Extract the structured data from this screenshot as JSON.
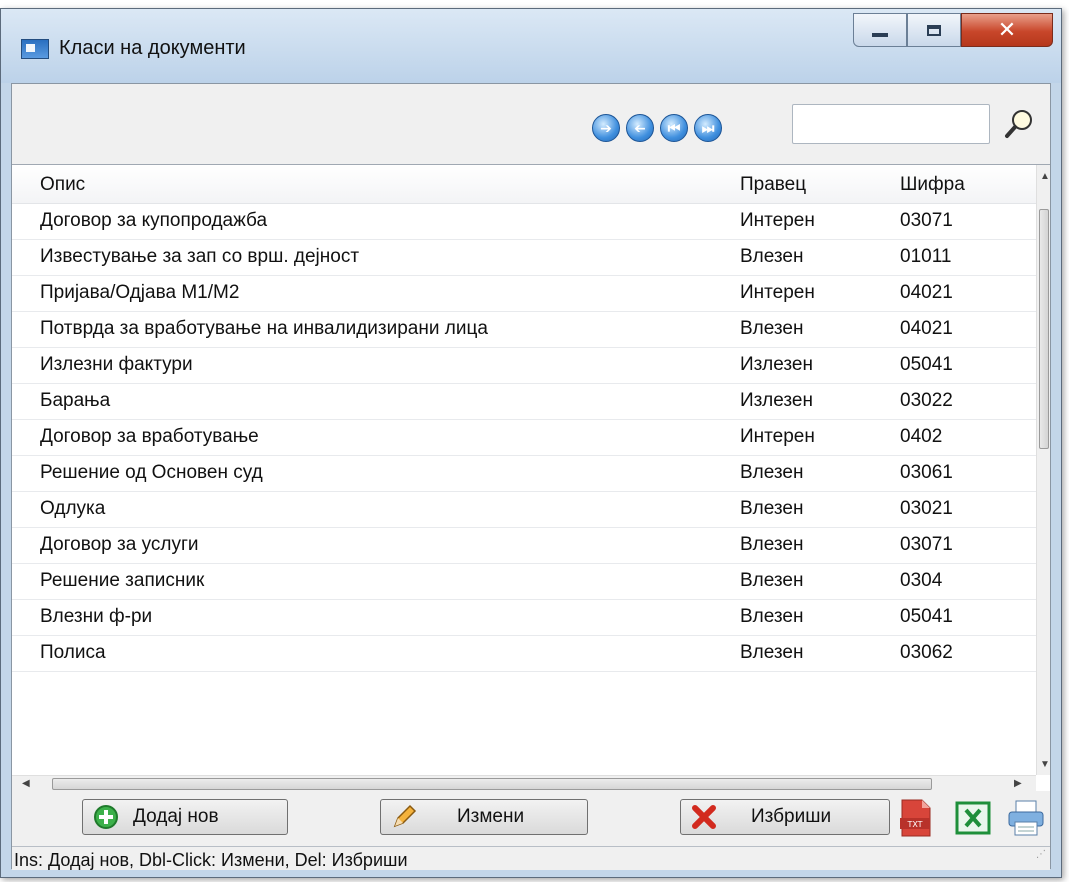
{
  "window": {
    "title": "Класи на документи"
  },
  "toolbar": {
    "search_value": ""
  },
  "grid": {
    "columns": [
      "Опис",
      "Правец",
      "Шифра"
    ],
    "rows": [
      [
        "Договор за купопродажба",
        "Интерен",
        "03071"
      ],
      [
        "Известување за зап со врш. дејност",
        "Влезен",
        "01011"
      ],
      [
        "Пријава/Одјава М1/М2",
        "Интерен",
        "04021"
      ],
      [
        "Потврда за вработување на инвалидизирани лица",
        "Влезен",
        "04021"
      ],
      [
        "Излезни фактури",
        "Излезен",
        "05041"
      ],
      [
        "Барања",
        "Излезен",
        "03022"
      ],
      [
        "Договор за вработување",
        "Интерен",
        "0402"
      ],
      [
        "Решение од Основен суд",
        "Влезен",
        "03061"
      ],
      [
        "Одлука",
        "Влезен",
        "03021"
      ],
      [
        "Договор за услуги",
        "Влезен",
        "03071"
      ],
      [
        "Решение записник",
        "Влезен",
        "0304"
      ],
      [
        "Влезни ф-ри",
        "Влезен",
        "05041"
      ],
      [
        "Полиса",
        "Влезен",
        "03062"
      ]
    ]
  },
  "buttons": {
    "add": "Додај нов",
    "edit": "Измени",
    "delete": "Избриши"
  },
  "status": {
    "text": "Ins: Додај нов, Dbl-Click: Измени, Del: Избриши"
  },
  "colors": {
    "accent": "#3f8fde",
    "close": "#c8462a",
    "excel": "#1e8f3a"
  }
}
